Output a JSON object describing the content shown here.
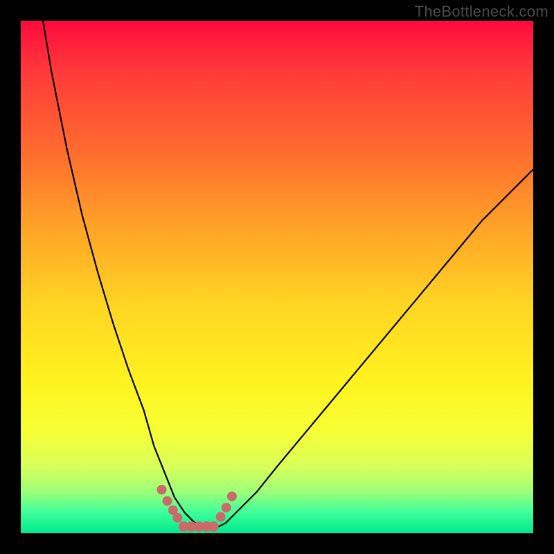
{
  "watermark": "TheBottleneck.com",
  "colors": {
    "curve_stroke": "#000000",
    "bottom_marker": "#cc6a6a",
    "background_black": "#000000"
  },
  "chart_data": {
    "type": "line",
    "title": "",
    "xlabel": "",
    "ylabel": "",
    "xlim": [
      0,
      100
    ],
    "ylim": [
      0,
      100
    ],
    "x": [
      0,
      3,
      6,
      9,
      12,
      15,
      18,
      21,
      24,
      26,
      28,
      30,
      32,
      34,
      36,
      38,
      40,
      42,
      46,
      50,
      55,
      60,
      65,
      70,
      75,
      80,
      85,
      90,
      95,
      100
    ],
    "values": [
      130,
      108,
      90,
      75,
      62,
      51,
      41,
      32,
      24,
      17,
      12,
      7,
      4,
      2,
      1,
      1,
      2,
      4,
      8,
      13,
      19,
      25,
      31,
      37,
      43,
      49,
      55,
      61,
      66,
      71
    ],
    "annotations": [
      {
        "kind": "bottom_dots",
        "x_range": [
          27,
          42
        ],
        "y": 2
      }
    ],
    "gradient_stops": [
      {
        "pos": 0.0,
        "color": "#ff0a3c"
      },
      {
        "pos": 0.25,
        "color": "#ff6a2f"
      },
      {
        "pos": 0.55,
        "color": "#ffd423"
      },
      {
        "pos": 0.8,
        "color": "#f6ff34"
      },
      {
        "pos": 1.0,
        "color": "#00e98f"
      }
    ]
  }
}
